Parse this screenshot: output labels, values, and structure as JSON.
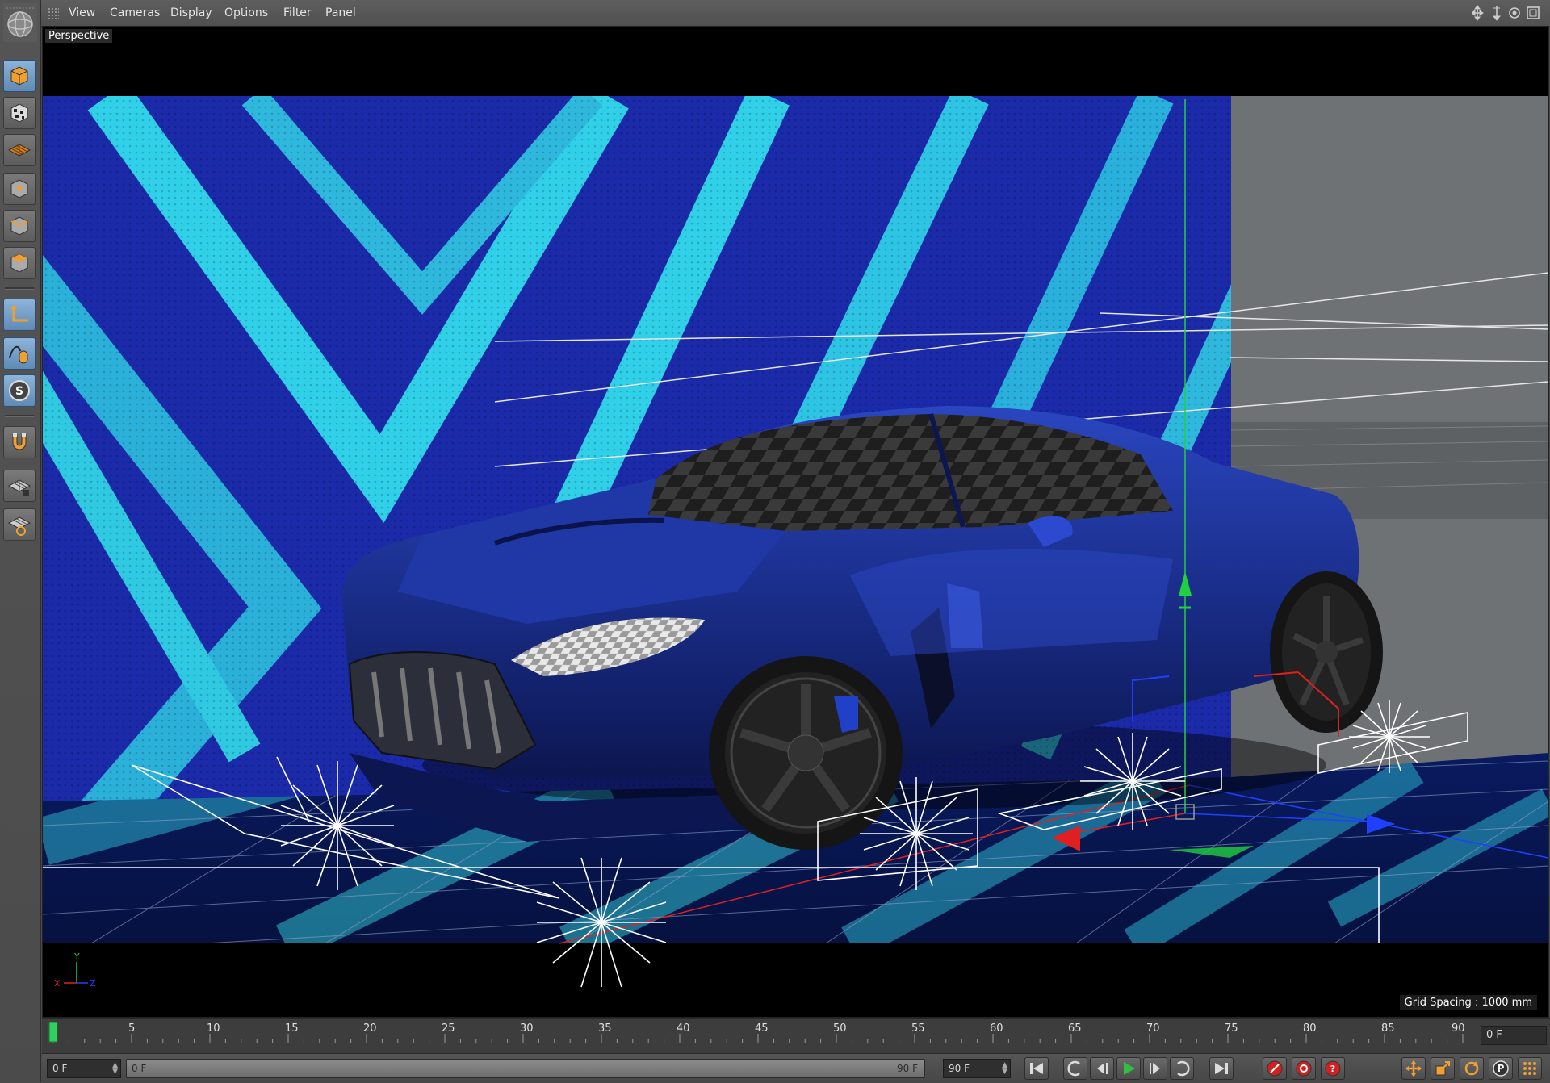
{
  "menu": {
    "items": [
      "View",
      "Cameras",
      "Display",
      "Options",
      "Filter",
      "Panel"
    ]
  },
  "viewport": {
    "label": "Perspective",
    "grid_spacing": "Grid Spacing : 1000 mm",
    "axis_labels": {
      "x": "X",
      "y": "Y",
      "z": "Z"
    }
  },
  "left_toolbar": {
    "tools": [
      "model-mode-icon",
      "texture-mode-icon",
      "workplane-icon",
      "points-mode-icon",
      "edges-mode-icon",
      "polygons-mode-icon",
      "axis-mode-icon",
      "tweak-mode-icon",
      "solo-icon",
      "snap-magnet-icon",
      "lock-workplane-icon",
      "workplane-snap-icon"
    ]
  },
  "timeline": {
    "ticks": [
      "0",
      "5",
      "10",
      "15",
      "20",
      "25",
      "30",
      "35",
      "40",
      "45",
      "50",
      "55",
      "60",
      "65",
      "70",
      "75",
      "80",
      "85",
      "90"
    ],
    "current_frame": "0 F",
    "current_marker_frame": 0
  },
  "transport": {
    "start_field": "0 F",
    "range_start": "0 F",
    "range_end": "90 F",
    "end_field": "90 F",
    "buttons": [
      "go-to-start-icon",
      "previous-key-icon",
      "previous-frame-icon",
      "play-icon",
      "next-frame-icon",
      "next-key-icon",
      "go-to-end-icon",
      "record-icon",
      "autokey-icon",
      "keyframe-selection-icon",
      "move-key-icon",
      "scale-key-icon",
      "rotate-key-icon",
      "param-key-icon",
      "point-level-icon",
      "timeline-layout-icon"
    ]
  },
  "colors": {
    "background_wall": "#1d2fb0",
    "stripe": "#33d6e8",
    "car_body": "#1a2e8a",
    "axis_x": "#e02020",
    "axis_y": "#20d040",
    "axis_z": "#2040ff",
    "selection_blue": "#5f8ab5"
  }
}
